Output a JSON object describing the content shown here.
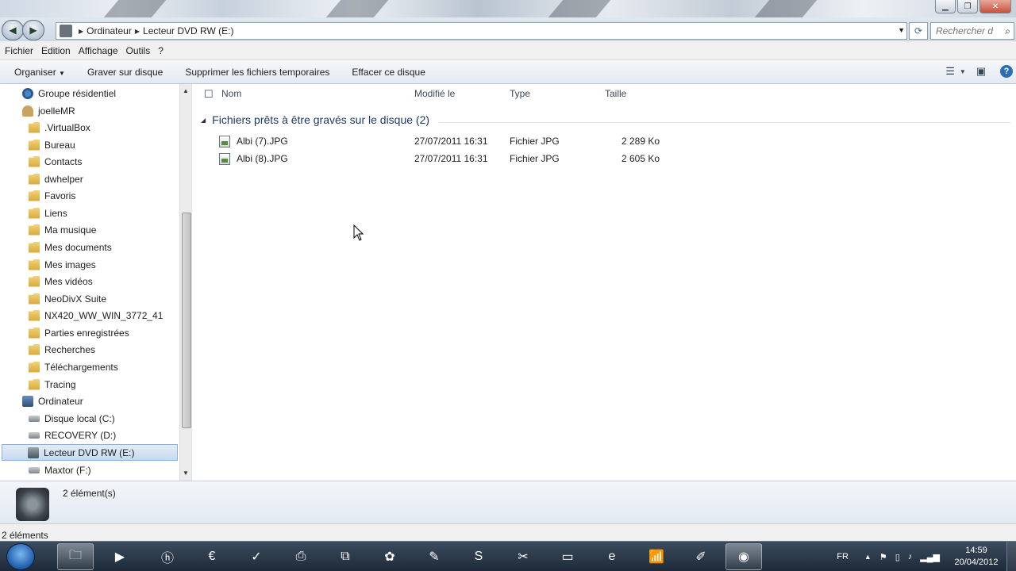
{
  "address": {
    "breadcrumbs": [
      "Ordinateur",
      "Lecteur DVD RW (E:)"
    ],
    "search_placeholder": "Rechercher d..."
  },
  "menu": [
    "Fichier",
    "Edition",
    "Affichage",
    "Outils",
    "?"
  ],
  "toolbar": {
    "organize": "Organiser",
    "burn": "Graver sur disque",
    "delete_temp": "Supprimer les fichiers temporaires",
    "erase": "Effacer ce disque"
  },
  "nav": {
    "items": [
      {
        "label": "Groupe résidentiel",
        "icon": "homegroup-icon"
      },
      {
        "label": "joelleMR",
        "icon": "user-folder-icon"
      },
      {
        "label": ".VirtualBox",
        "icon": "folder-icon"
      },
      {
        "label": "Bureau",
        "icon": "folder-icon"
      },
      {
        "label": "Contacts",
        "icon": "folder-icon"
      },
      {
        "label": "dwhelper",
        "icon": "folder-icon"
      },
      {
        "label": "Favoris",
        "icon": "folder-icon"
      },
      {
        "label": "Liens",
        "icon": "folder-icon"
      },
      {
        "label": "Ma musique",
        "icon": "folder-icon"
      },
      {
        "label": "Mes documents",
        "icon": "folder-icon"
      },
      {
        "label": "Mes images",
        "icon": "folder-icon"
      },
      {
        "label": "Mes vidéos",
        "icon": "folder-icon"
      },
      {
        "label": "NeoDivX Suite",
        "icon": "folder-icon"
      },
      {
        "label": "NX420_WW_WIN_3772_41",
        "icon": "folder-icon"
      },
      {
        "label": "Parties enregistrées",
        "icon": "folder-icon"
      },
      {
        "label": "Recherches",
        "icon": "folder-icon"
      },
      {
        "label": "Téléchargements",
        "icon": "folder-icon"
      },
      {
        "label": "Tracing",
        "icon": "folder-icon"
      },
      {
        "label": "Ordinateur",
        "icon": "computer-icon"
      },
      {
        "label": "Disque local (C:)",
        "icon": "drive-icon"
      },
      {
        "label": "RECOVERY (D:)",
        "icon": "drive-icon"
      },
      {
        "label": "Lecteur DVD RW (E:)",
        "icon": "dvd-drive-icon"
      },
      {
        "label": "Maxtor (F:)",
        "icon": "drive-icon"
      }
    ]
  },
  "columns": {
    "name": "Nom",
    "modified": "Modifié le",
    "type": "Type",
    "size": "Taille"
  },
  "group": {
    "title": "Fichiers prêts à être gravés sur le disque (2)"
  },
  "files": [
    {
      "name": "Albi (7).JPG",
      "modified": "27/07/2011 16:31",
      "type": "Fichier JPG",
      "size": "2 289 Ko"
    },
    {
      "name": "Albi (8).JPG",
      "modified": "27/07/2011 16:31",
      "type": "Fichier JPG",
      "size": "2 605 Ko"
    }
  ],
  "details": {
    "count": "2 élément(s)"
  },
  "status": {
    "text": "2 éléments"
  },
  "tray": {
    "lang": "FR",
    "time": "14:59",
    "date": "20/04/2012"
  }
}
